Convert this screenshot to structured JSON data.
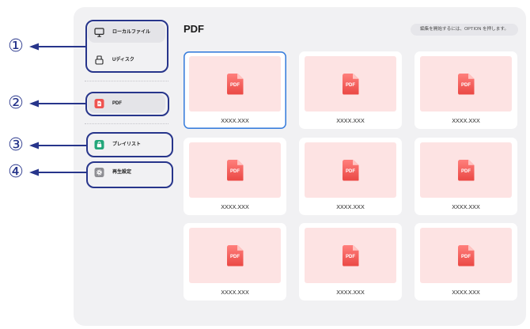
{
  "callouts": [
    "①",
    "②",
    "③",
    "④"
  ],
  "sidebar": {
    "items": [
      {
        "label": "ローカルファイル",
        "icon": "monitor-icon",
        "active": true
      },
      {
        "label": "Uディスク",
        "icon": "usb-drive-icon",
        "active": false
      },
      {
        "label": "PDF",
        "icon": "pdf-icon",
        "active": true
      },
      {
        "label": "プレイリスト",
        "icon": "playlist-icon",
        "active": false
      },
      {
        "label": "再生設定",
        "icon": "gear-icon",
        "active": false
      }
    ]
  },
  "main": {
    "title": "PDF",
    "hint": "編集を開始するには、OPTION を押します。",
    "files": [
      {
        "name": "XXXX.XXX",
        "type_label": "PDF",
        "selected": true
      },
      {
        "name": "XXXX.XXX",
        "type_label": "PDF",
        "selected": false
      },
      {
        "name": "XXXX.XXX",
        "type_label": "PDF",
        "selected": false
      },
      {
        "name": "XXXX.XXX",
        "type_label": "PDF",
        "selected": false
      },
      {
        "name": "XXXX.XXX",
        "type_label": "PDF",
        "selected": false
      },
      {
        "name": "XXXX.XXX",
        "type_label": "PDF",
        "selected": false
      },
      {
        "name": "XXXX.XXX",
        "type_label": "PDF",
        "selected": false
      },
      {
        "name": "XXXX.XXX",
        "type_label": "PDF",
        "selected": false
      },
      {
        "name": "XXXX.XXX",
        "type_label": "PDF",
        "selected": false
      }
    ]
  },
  "colors": {
    "annotation": "#27358b",
    "selection": "#3b7fdc",
    "pdf_red": "#ef5350",
    "thumb_bg": "#fde3e3",
    "playlist_green": "#22a67a",
    "settings_gray": "#8e8e93",
    "panel_bg": "#f1f1f3",
    "active_bg": "#e4e4e8"
  }
}
